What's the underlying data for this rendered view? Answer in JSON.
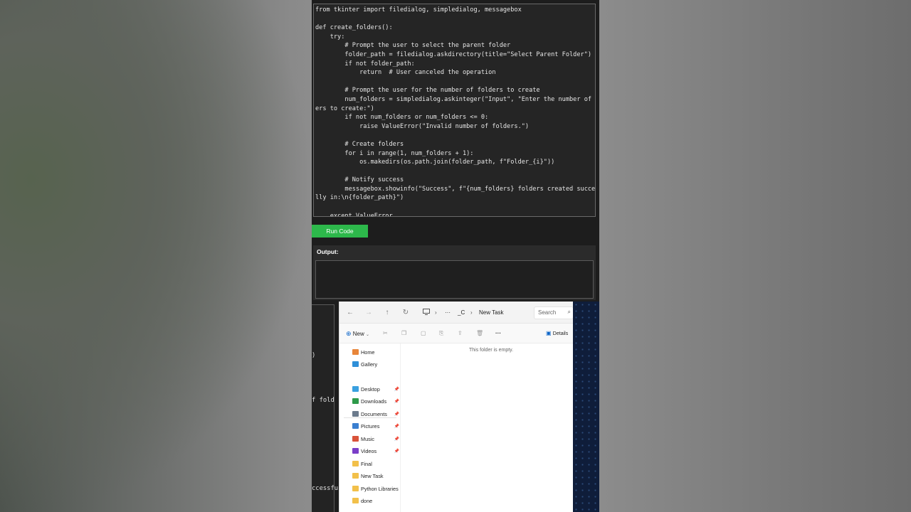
{
  "code_editor": {
    "lines": [
      "from tkinter import filedialog, simpledialog, messagebox",
      "",
      "def create_folders():",
      "    try:",
      "        # Prompt the user to select the parent folder",
      "        folder_path = filedialog.askdirectory(title=\"Select Parent Folder\")",
      "        if not folder_path:",
      "            return  # User canceled the operation",
      "",
      "        # Prompt the user for the number of folders to create",
      "        num_folders = simpledialog.askinteger(\"Input\", \"Enter the number of fold",
      "ers to create:\")",
      "        if not num_folders or num_folders <= 0:",
      "            raise ValueError(\"Invalid number of folders.\")",
      "",
      "        # Create folders",
      "        for i in range(1, num_folders + 1):",
      "            os.makedirs(os.path.join(folder_path, f\"Folder_{i}\"))",
      "",
      "        # Notify success",
      "        messagebox.showinfo(\"Success\", f\"{num_folders} folders created successfu",
      "lly in:\\n{folder_path}\")",
      "",
      "    except ValueError"
    ]
  },
  "run_button": {
    "label": "Run Code"
  },
  "output": {
    "label": "Output:",
    "value": ""
  },
  "background_code": {
    "fragments": [
      ")",
      "f fold",
      "ccessfu"
    ]
  },
  "explorer": {
    "breadcrumb": [
      "_C",
      "New Task"
    ],
    "search_placeholder": "Search",
    "toolbar": {
      "new_label": "New",
      "details_label": "Details"
    },
    "sidebar": [
      {
        "label": "Home",
        "icon": "home-icon",
        "color": "#e8863a",
        "pinned": false
      },
      {
        "label": "Gallery",
        "icon": "gallery-icon",
        "color": "#2f8fd8",
        "pinned": false
      },
      {
        "label": "Desktop",
        "icon": "desktop-icon",
        "color": "#3aa0e0",
        "pinned": true
      },
      {
        "label": "Downloads",
        "icon": "downloads-icon",
        "color": "#2e9a4a",
        "pinned": true
      },
      {
        "label": "Documents",
        "icon": "documents-icon",
        "color": "#6b7a8c",
        "pinned": true
      },
      {
        "label": "Pictures",
        "icon": "pictures-icon",
        "color": "#3a7fd0",
        "pinned": true
      },
      {
        "label": "Music",
        "icon": "music-icon",
        "color": "#d9533a",
        "pinned": true
      },
      {
        "label": "Videos",
        "icon": "videos-icon",
        "color": "#7a3ec8",
        "pinned": true
      },
      {
        "label": "Final",
        "icon": "folder-icon",
        "color": "#f2c04a",
        "pinned": false
      },
      {
        "label": "New Task",
        "icon": "folder-icon",
        "color": "#f2c04a",
        "pinned": false
      },
      {
        "label": "Python Libraries",
        "icon": "folder-icon",
        "color": "#f2c04a",
        "pinned": false
      },
      {
        "label": "done",
        "icon": "folder-icon",
        "color": "#f2c04a",
        "pinned": false
      }
    ],
    "empty_message": "This folder is empty."
  },
  "colors": {
    "run_button": "#2db84b",
    "editor_bg": "#252525",
    "navy_panel": "#0f1d3a"
  }
}
